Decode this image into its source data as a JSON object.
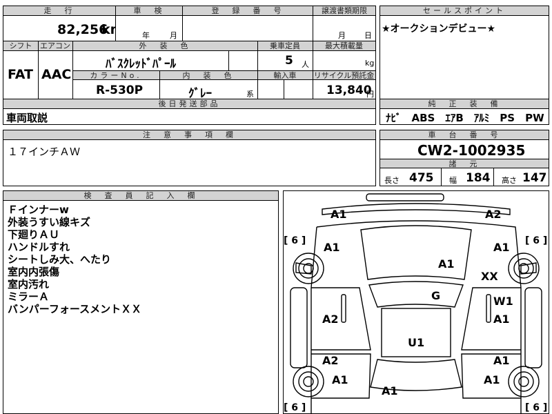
{
  "header": {
    "mileage_label": "走　行",
    "inspection_label": "車　検",
    "registration_label": "登　録　番　号",
    "transfer_label": "譲渡書類期限",
    "sales_point_label": "セールスポイント",
    "mileage_value": "82,256",
    "mileage_unit": "km",
    "year_unit": "年",
    "month_unit": "月",
    "transfer_month": "月",
    "transfer_day": "日",
    "sales_point_text": "★オークションデビュー★"
  },
  "spec": {
    "shift_label": "シフト",
    "ac_label": "エアコン",
    "exterior_label": "外　装　色",
    "capacity_label": "乗車定員",
    "max_load_label": "最大積載量",
    "shift_value": "FAT",
    "ac_value": "AAC",
    "exterior_value": "ﾊﾞｽｸﾚｯﾄﾞﾊﾟｰﾙ",
    "capacity_value": "5",
    "capacity_unit": "人",
    "max_load_unit": "kg",
    "color_no_label": "カラーNo.",
    "interior_label": "内　装　色",
    "import_label": "輸入車",
    "recycle_label": "リサイクル預託金",
    "color_no_value": "R-530P",
    "interior_value": "ｸﾞﾚｰ",
    "interior_suffix": "系",
    "recycle_value": "13,840",
    "recycle_unit": "円"
  },
  "parts": {
    "label": "後日発送部品",
    "value": "車両取説"
  },
  "equipment": {
    "label": "純　正　装　備",
    "value": "ﾅﾋﾞ　ABS　ｴｱB　ｱﾙﾐ　PS　PW"
  },
  "notes": {
    "label": "注　意　事　項　欄",
    "value": "１７インチＡＷ"
  },
  "chassis": {
    "label": "車　台　番　号",
    "value": "CW2-1002935"
  },
  "dims": {
    "label": "諸　元",
    "length_label": "長さ",
    "length_value": "475",
    "width_label": "幅",
    "width_value": "184",
    "height_label": "高さ",
    "height_value": "147"
  },
  "inspector": {
    "label": "検　査　員　記　入　欄",
    "lines": [
      "Ｆインナーw",
      "外装うすい線キズ",
      "下廻りＡＵ",
      "ハンドルすれ",
      "シートしみ大、へたり",
      "室内内張傷",
      "室内汚れ",
      "ミラーＡ",
      "バンパーフォースメントＸＸ"
    ]
  },
  "diagram": {
    "marks": [
      "A1",
      "A2",
      "A1",
      "A1",
      "A1",
      "XX",
      "G",
      "W1",
      "A2",
      "A1",
      "U1",
      "A2",
      "A1",
      "A1",
      "A1",
      "A1"
    ],
    "tire_label": "[ 6 ]"
  }
}
